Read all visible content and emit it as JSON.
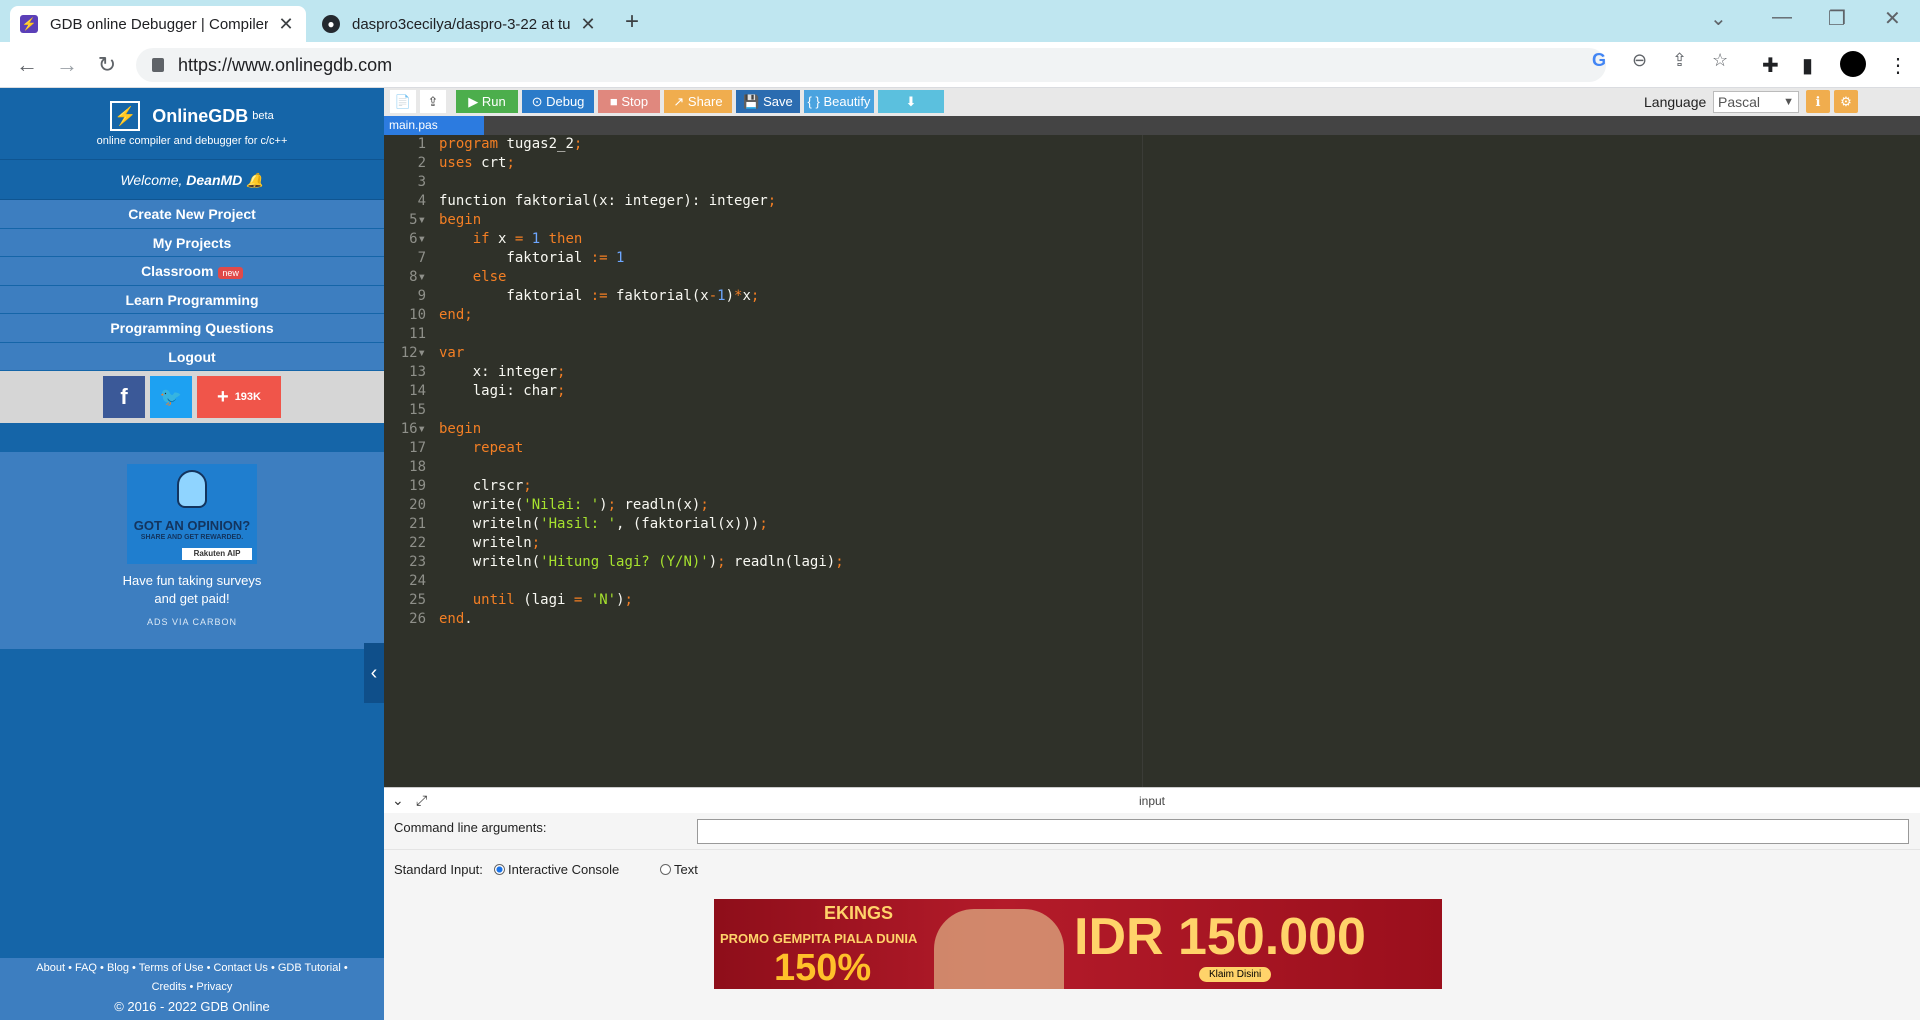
{
  "browser": {
    "tabs": [
      {
        "title": "GDB online Debugger | Compiler",
        "active": true
      },
      {
        "title": "daspro3cecilya/daspro-3-22 at tu",
        "active": false
      }
    ],
    "url": "https://www.onlinegdb.com",
    "icons": [
      "back-icon",
      "forward-icon",
      "reload-icon",
      "lock-icon",
      "google-icon",
      "zoom-icon",
      "share-icon",
      "star-icon",
      "extensions-icon",
      "sidepanel-icon",
      "profile-icon",
      "menu-icon"
    ]
  },
  "sidebar": {
    "brand": "OnlineGDB",
    "beta": "beta",
    "tagline": "online compiler and debugger for c/c++",
    "welcome_prefix": "Welcome, ",
    "user": "DeanMD",
    "menu": [
      {
        "label": "Create New Project"
      },
      {
        "label": "My Projects"
      },
      {
        "label": "Classroom",
        "badge": "new"
      },
      {
        "label": "Learn Programming"
      },
      {
        "label": "Programming Questions"
      },
      {
        "label": "Logout"
      }
    ],
    "social_count": "193K",
    "ad": {
      "headline": "GOT AN OPINION?",
      "sub": "SHARE AND GET REWARDED.",
      "logo": "Rakuten AIP",
      "text1": "Have fun taking surveys",
      "text2": "and get paid!",
      "via": "ADS VIA CARBON"
    },
    "footer": {
      "line1": "About • FAQ • Blog • Terms of Use • Contact Us • GDB Tutorial •",
      "line2": "Credits • Privacy",
      "copy": "© 2016 - 2022 GDB Online"
    }
  },
  "toolbar": {
    "run": "Run",
    "debug": "Debug",
    "stop": "Stop",
    "share": "Share",
    "save": "Save",
    "beautify": "{ } Beautify",
    "language_label": "Language",
    "language": "Pascal",
    "colors": {
      "run": "#4cae4c",
      "debug": "#2b7bc9",
      "stop": "#e0887e",
      "share": "#f0ad4e",
      "save": "#2b6cb0",
      "beautify": "#4aa3df",
      "download": "#5bc0de",
      "info": "#f0ad4e"
    }
  },
  "editor": {
    "filename": "main.pas",
    "lines": [
      [
        [
          "kw",
          "program"
        ],
        [
          "pun",
          " tugas2_2"
        ],
        [
          "op",
          ";"
        ]
      ],
      [
        [
          "kw",
          "uses"
        ],
        [
          "pun",
          " crt"
        ],
        [
          "op",
          ";"
        ]
      ],
      [],
      [
        [
          "pun",
          "function faktorial(x: integer): integer"
        ],
        [
          "op",
          ";"
        ]
      ],
      [
        [
          "kw",
          "begin"
        ]
      ],
      [
        [
          "pun",
          "    "
        ],
        [
          "kw",
          "if"
        ],
        [
          "pun",
          " x "
        ],
        [
          "op",
          "="
        ],
        [
          "pun",
          " "
        ],
        [
          "num",
          "1"
        ],
        [
          "pun",
          " "
        ],
        [
          "kw",
          "then"
        ]
      ],
      [
        [
          "pun",
          "        faktorial "
        ],
        [
          "op",
          ":="
        ],
        [
          "pun",
          " "
        ],
        [
          "num",
          "1"
        ]
      ],
      [
        [
          "pun",
          "    "
        ],
        [
          "kw",
          "else"
        ]
      ],
      [
        [
          "pun",
          "        faktorial "
        ],
        [
          "op",
          ":="
        ],
        [
          "pun",
          " faktorial(x"
        ],
        [
          "op",
          "-"
        ],
        [
          "num",
          "1"
        ],
        [
          "pun",
          ")"
        ],
        [
          "op",
          "*"
        ],
        [
          "pun",
          "x"
        ],
        [
          "op",
          ";"
        ]
      ],
      [
        [
          "kw",
          "end"
        ],
        [
          "op",
          ";"
        ]
      ],
      [],
      [
        [
          "kw",
          "var"
        ]
      ],
      [
        [
          "pun",
          "    x: integer"
        ],
        [
          "op",
          ";"
        ]
      ],
      [
        [
          "pun",
          "    lagi: char"
        ],
        [
          "op",
          ";"
        ]
      ],
      [],
      [
        [
          "kw",
          "begin"
        ]
      ],
      [
        [
          "pun",
          "    "
        ],
        [
          "kw",
          "repeat"
        ]
      ],
      [],
      [
        [
          "pun",
          "    clrscr"
        ],
        [
          "op",
          ";"
        ]
      ],
      [
        [
          "pun",
          "    write("
        ],
        [
          "str",
          "'Nilai: '"
        ],
        [
          "pun",
          ")"
        ],
        [
          "op",
          ";"
        ],
        [
          "pun",
          " readln(x)"
        ],
        [
          "op",
          ";"
        ]
      ],
      [
        [
          "pun",
          "    writeln("
        ],
        [
          "str",
          "'Hasil: '"
        ],
        [
          "pun",
          ", (faktorial(x)))"
        ],
        [
          "op",
          ";"
        ]
      ],
      [
        [
          "pun",
          "    writeln"
        ],
        [
          "op",
          ";"
        ]
      ],
      [
        [
          "pun",
          "    writeln("
        ],
        [
          "str",
          "'Hitung lagi? (Y/N)'"
        ],
        [
          "pun",
          ")"
        ],
        [
          "op",
          ";"
        ],
        [
          "pun",
          " readln(lagi)"
        ],
        [
          "op",
          ";"
        ]
      ],
      [],
      [
        [
          "pun",
          "    "
        ],
        [
          "kw",
          "until"
        ],
        [
          "pun",
          " (lagi "
        ],
        [
          "op",
          "="
        ],
        [
          "pun",
          " "
        ],
        [
          "str",
          "'N'"
        ],
        [
          "pun",
          ")"
        ],
        [
          "op",
          ";"
        ]
      ],
      [
        [
          "kw",
          "end"
        ],
        [
          "pun",
          "."
        ]
      ]
    ],
    "fold_lines": [
      5,
      6,
      8,
      12,
      16
    ]
  },
  "io": {
    "panel_label": "input",
    "args_label": "Command line arguments:",
    "stdin_label": "Standard Input:",
    "opt_console": "Interactive Console",
    "opt_text": "Text",
    "console_selected": true
  },
  "banner": {
    "brand": "EKINGS",
    "promo": "PROMO GEMPITA PIALA DUNIA",
    "pct": "150%",
    "amount": "IDR 150.000",
    "cta": "Klaim Disini"
  }
}
